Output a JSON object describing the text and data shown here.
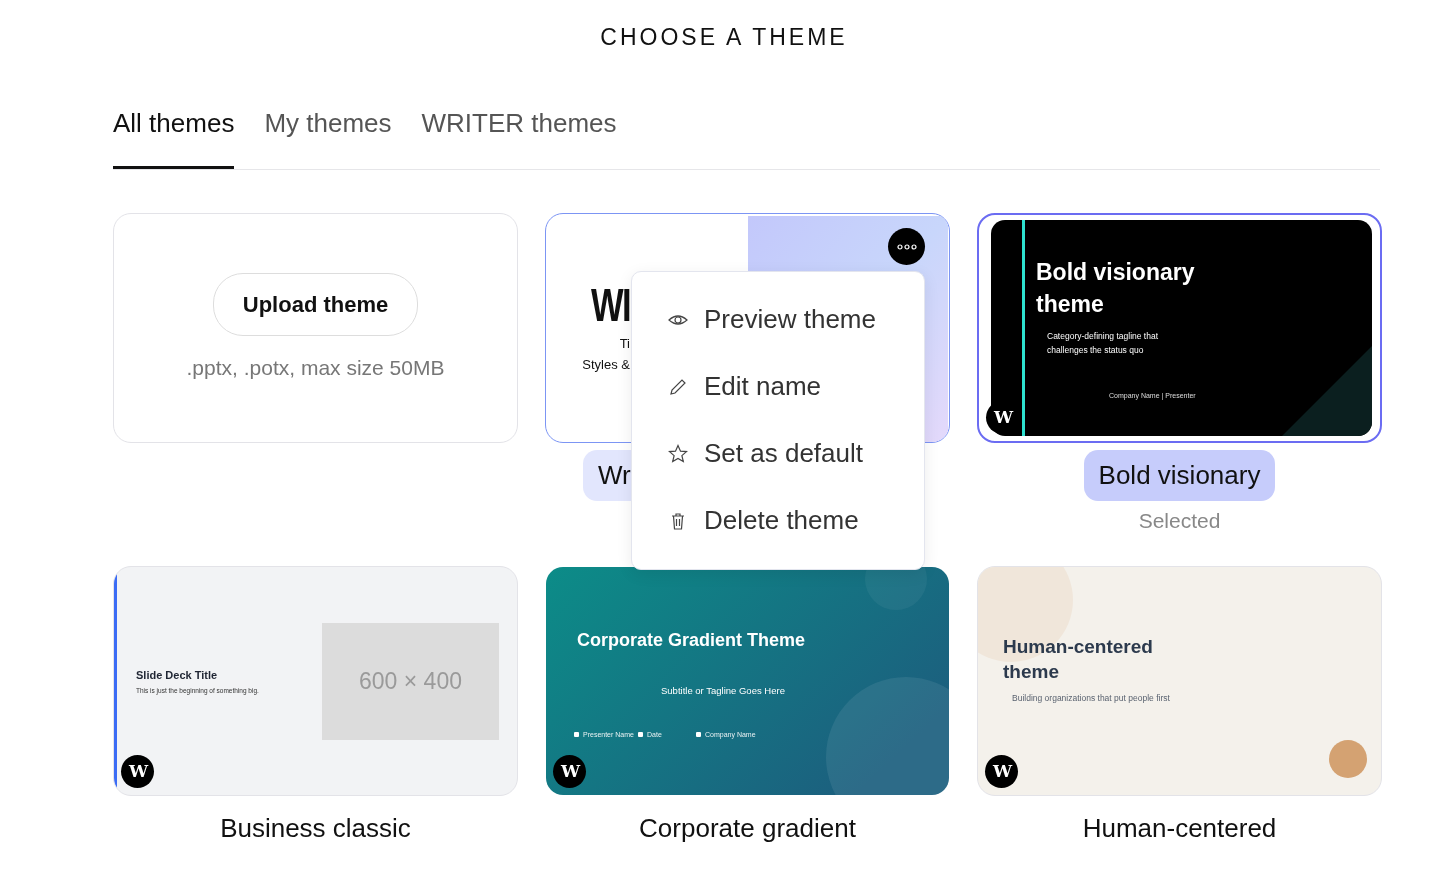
{
  "heading": "CHOOSE A THEME",
  "tabs": [
    {
      "label": "All themes",
      "selected": true
    },
    {
      "label": "My themes",
      "selected": false
    },
    {
      "label": "WRITER themes",
      "selected": false
    }
  ],
  "upload": {
    "button": "Upload theme",
    "note": ".pptx, .potx, max size 50MB"
  },
  "themes": [
    {
      "name": "Wr",
      "selected": false,
      "menu_open": true,
      "preview": {
        "kind": "writer",
        "title": "WI",
        "subtitle": "Ti",
        "caption": "Styles &"
      }
    },
    {
      "name": "Bold visionary",
      "selected": true,
      "status": "Selected",
      "menu_open": false,
      "logo": "W",
      "preview": {
        "kind": "dark",
        "title": "Bold visionary theme",
        "tagline": "Category-defining tagline that challenges the status quo",
        "footer": "Company Name | Presenter"
      }
    },
    {
      "name": "Business classic",
      "selected": false,
      "menu_open": false,
      "logo": "W",
      "preview": {
        "kind": "classic",
        "title": "Slide Deck Title",
        "tagline": "This is just the beginning of something big.",
        "placeholder": "600 × 400"
      }
    },
    {
      "name": "Corporate gradient",
      "selected": false,
      "menu_open": false,
      "logo": "W",
      "preview": {
        "kind": "gradient",
        "title": "Corporate Gradient Theme",
        "tagline": "Subtitle or Tagline Goes Here",
        "meta": [
          "Presenter Name",
          "Date",
          "Company Name"
        ]
      }
    },
    {
      "name": "Human-centered",
      "selected": false,
      "menu_open": false,
      "logo": "W",
      "preview": {
        "kind": "warm",
        "title": "Human-centered theme",
        "tagline": "Building organizations that put people first"
      }
    }
  ],
  "menu": {
    "items": [
      {
        "label": "Preview theme"
      },
      {
        "label": "Edit name"
      },
      {
        "label": "Set as default"
      },
      {
        "label": "Delete theme"
      }
    ]
  }
}
